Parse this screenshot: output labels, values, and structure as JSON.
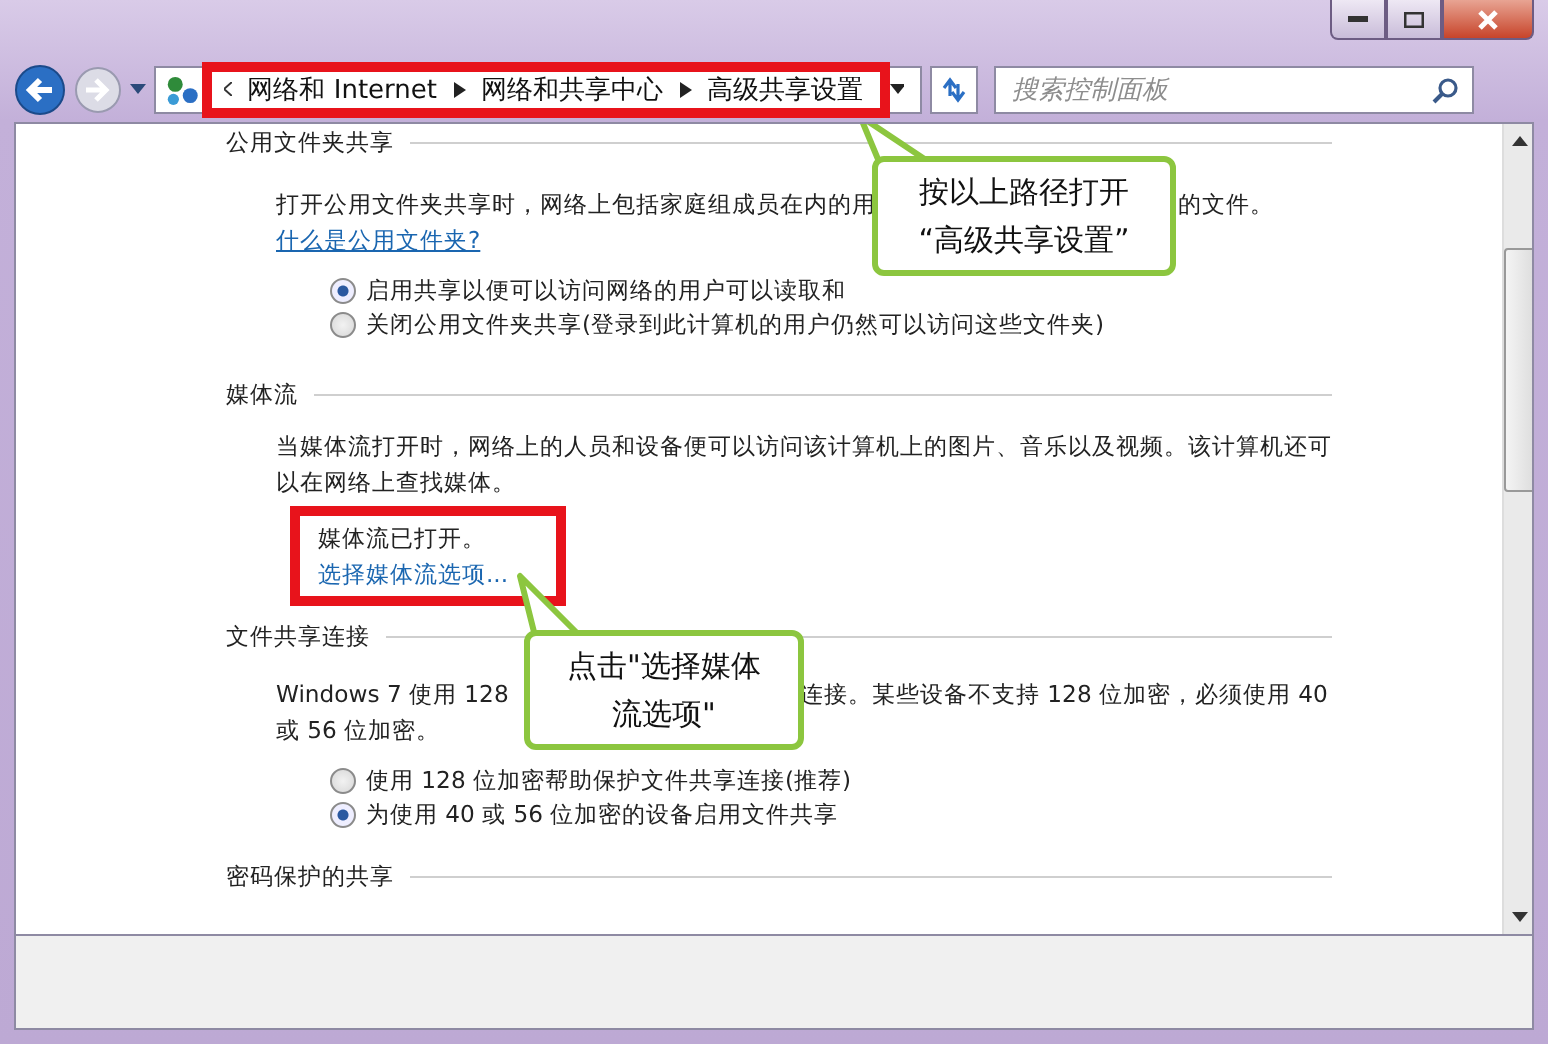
{
  "address_bar": {
    "highlighted": true,
    "breadcrumb": [
      "网络和 Internet",
      "网络和共享中心",
      "高级共享设置"
    ],
    "search": {
      "placeholder": "搜索控制面板"
    }
  },
  "sections": [
    {
      "heading": "公用文件夹共享",
      "description": {
        "before": "打开公用文件夹共享时，网络上包括家庭组成员在内的用",
        "after": "的文件。",
        "link": "什么是公用文件夹?"
      },
      "options": [
        {
          "label": "启用共享以便可以访问网络的用户可以读取和",
          "selected": true
        },
        {
          "label": "关闭公用文件夹共享(登录到此计算机的用户仍然可以访问这些文件夹)",
          "selected": false
        }
      ]
    },
    {
      "heading": "媒体流",
      "description": {
        "before": "当媒体流打开时，网络上的人员和设备便可以访问该计算机上的图片、音乐以及视频。该计算机还可以在网络上查找媒体。"
      },
      "status": {
        "highlighted": true,
        "text": "媒体流已打开。",
        "link": "选择媒体流选项..."
      }
    },
    {
      "heading": "文件共享连接",
      "description": {
        "before": "Windows 7 使用 128",
        "after": "连接。某些设备不支持 128 位加密，必须使用 40",
        "continuation": "或 56 位加密。"
      },
      "options": [
        {
          "label": "使用 128 位加密帮助保护文件共享连接(推荐)",
          "selected": false
        },
        {
          "label": "为使用 40 或 56 位加密的设备启用文件共享",
          "selected": true
        }
      ]
    },
    {
      "heading": "密码保护的共享"
    }
  ],
  "callouts": [
    {
      "lines": [
        "按以上路径打开",
        "“高级共享设置”"
      ]
    },
    {
      "lines": [
        "点击\"选择媒体",
        "流选项\""
      ]
    }
  ]
}
